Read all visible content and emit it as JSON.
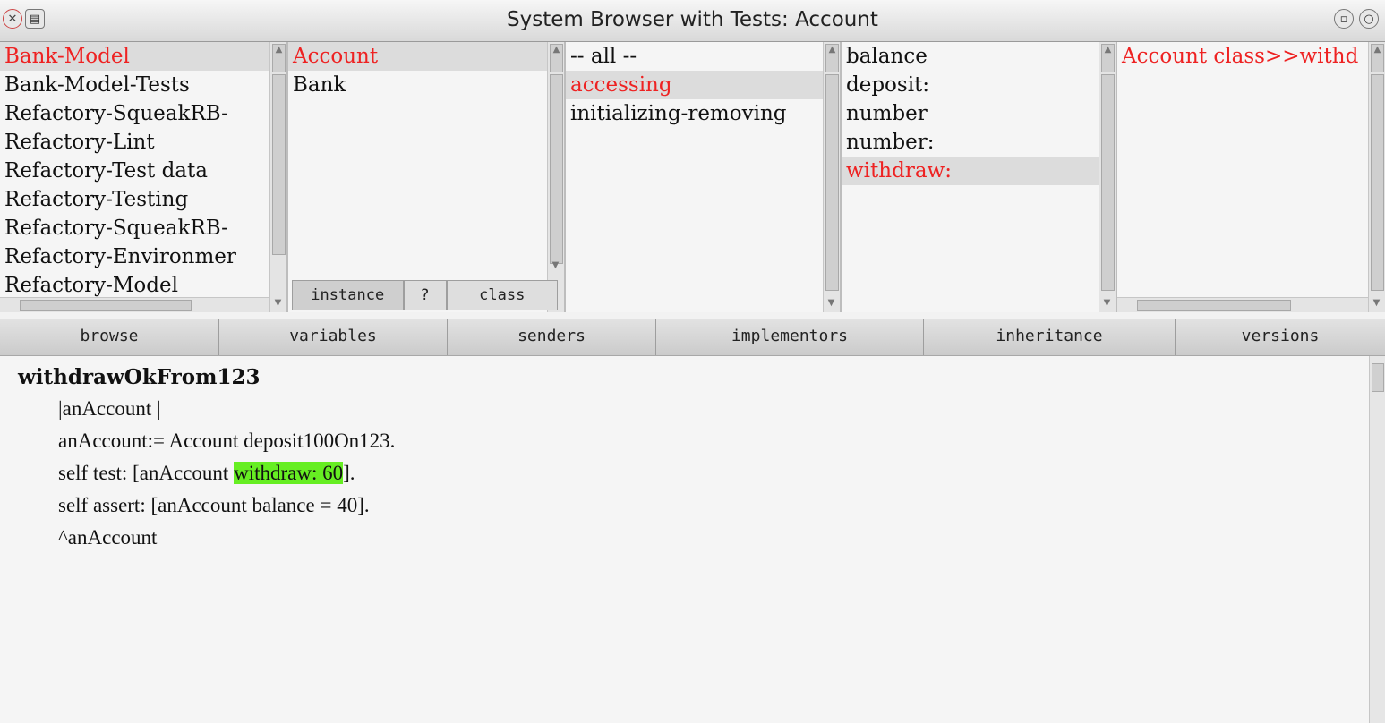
{
  "window": {
    "title": "System Browser with Tests: Account"
  },
  "titlebar_icons": {
    "close": "close-icon",
    "menu": "window-menu-icon",
    "collapse": "collapse-icon",
    "expand": "expand-icon"
  },
  "packages": [
    "Bank-Model",
    "Bank-Model-Tests",
    "Refactory-SqueakRB-",
    "Refactory-Lint",
    "Refactory-Test data",
    "Refactory-Testing",
    "Refactory-SqueakRB-",
    "Refactory-Environmer",
    "Refactory-Model"
  ],
  "classes": [
    "Account",
    "Bank"
  ],
  "class_switch": {
    "instance": "instance",
    "help": "?",
    "class": "class"
  },
  "protocols": [
    "-- all --",
    "accessing",
    "initializing-removing"
  ],
  "methods": [
    "balance",
    "deposit:",
    "number",
    "number:",
    "withdraw:"
  ],
  "tests": [
    "Account class>>withd"
  ],
  "buttons": [
    "browse",
    "variables",
    "senders",
    "implementors",
    "inheritance",
    "versions"
  ],
  "code": {
    "method_name": "withdrawOkFrom123",
    "line1": "|anAccount |",
    "line2": "anAccount:= Account deposit100On123.",
    "line3_pre": "self test: [anAccount ",
    "line3_hl": "withdraw: 60",
    "line3_post": "].",
    "line4": "self assert: [anAccount balance = 40].",
    "line5": "^anAccount"
  },
  "colors": {
    "selection_text": "#ee2222",
    "highlight": "#66ee22"
  }
}
